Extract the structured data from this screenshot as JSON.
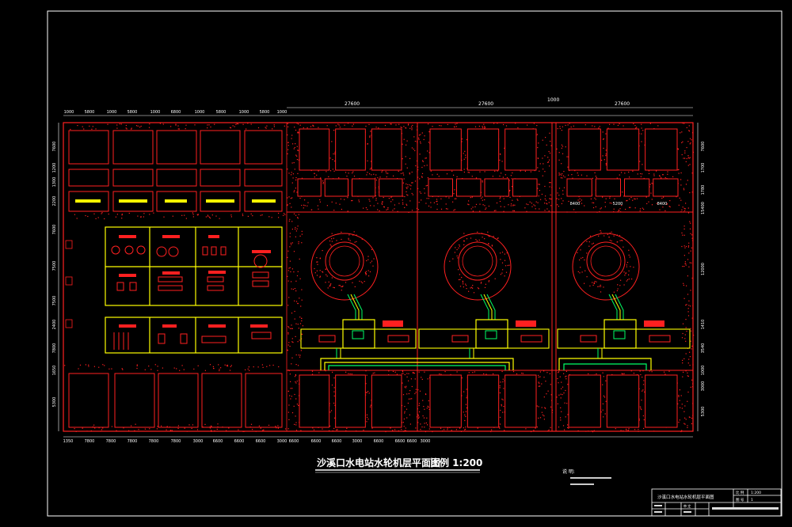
{
  "drawing": {
    "title": "沙溪口水电站水轮机层平面图",
    "scale": "比例 1:200",
    "notes_heading": "说 明:",
    "notes": [
      "",
      ""
    ]
  },
  "top_dimensions_upper": [
    "27600",
    "1000",
    "27600",
    "27600"
  ],
  "top_dimensions_lower": [
    "1000",
    "5800",
    "1000",
    "5800",
    "1000",
    "6800",
    "1000",
    "5800",
    "1000",
    "5800",
    "1000"
  ],
  "bottom_dimensions": [
    "1350",
    "7800",
    "7800",
    "7800",
    "7800",
    "7800",
    "3000",
    "6600",
    "6600",
    "6600",
    "3000",
    "6600",
    "6600",
    "6600",
    "3000",
    "6600",
    "6600",
    "6600",
    "3000"
  ],
  "right_dimensions": [
    "7600",
    "1700",
    "1780",
    "15400",
    "12000",
    "1410",
    "3540",
    "1000",
    "3000",
    "5300"
  ],
  "left_dimensions": [
    "7600",
    "1200",
    "1300",
    "2200",
    "7600",
    "7500",
    "7500",
    "2400",
    "7800",
    "1650",
    "5300"
  ],
  "gallery_dimensions": [
    "8400",
    "5200",
    "8400"
  ],
  "title_block": {
    "drawing_name": "沙溪口水电站水轮机层平面图",
    "field_scale_label": "比 例",
    "field_scale_value": "1:200",
    "field_sheet_label": "图 号",
    "field_sheet_value": "1",
    "row_a": "",
    "row_b": "审 定",
    "row_c": "",
    "school": ""
  }
}
